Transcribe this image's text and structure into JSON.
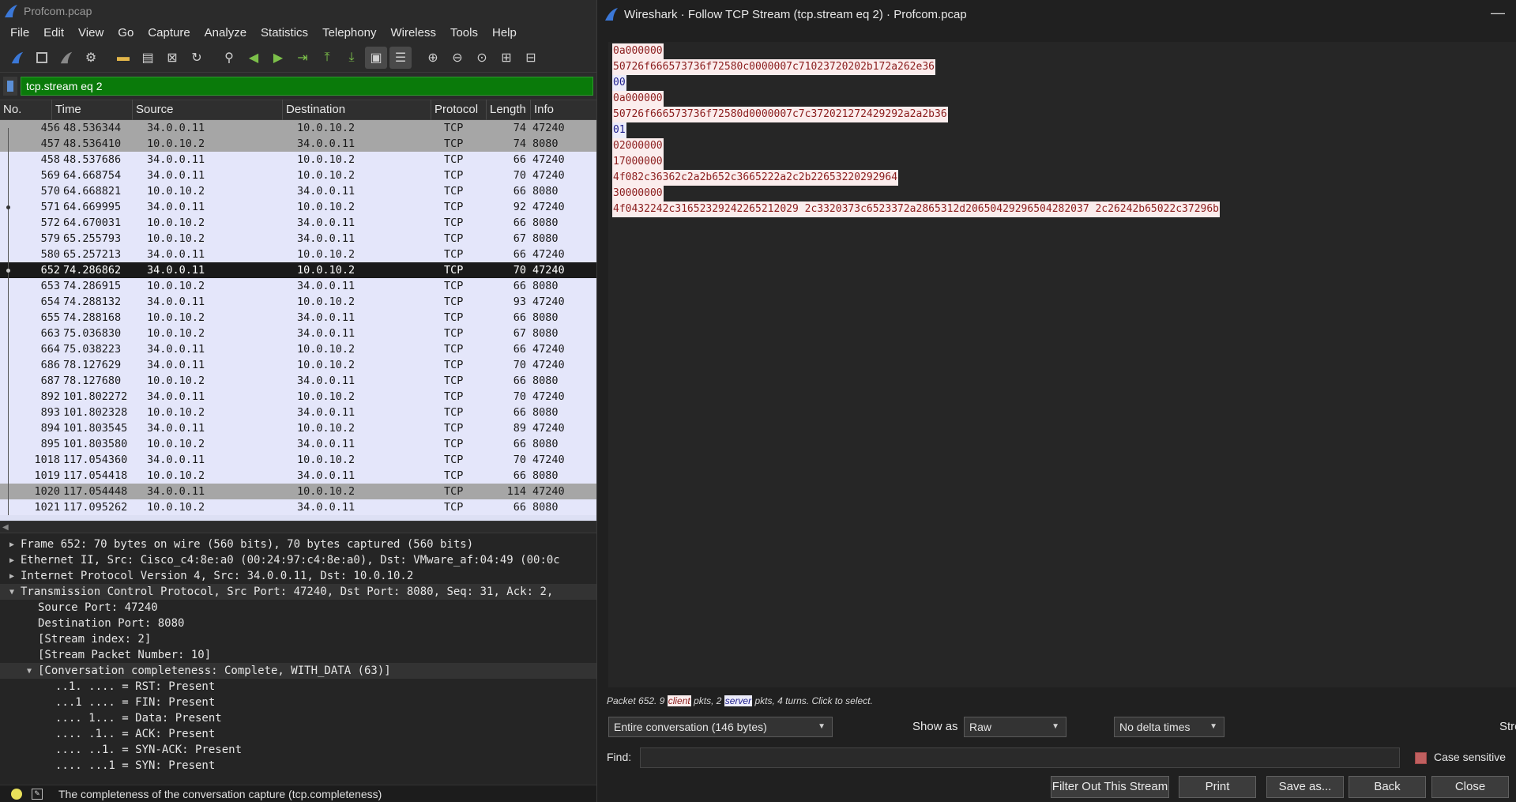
{
  "main_window": {
    "title": "Profcom.pcap",
    "menu": [
      "File",
      "Edit",
      "View",
      "Go",
      "Capture",
      "Analyze",
      "Statistics",
      "Telephony",
      "Wireless",
      "Tools",
      "Help"
    ],
    "filter_value": "tcp.stream eq 2",
    "columns": [
      "No.",
      "Time",
      "Source",
      "Destination",
      "Protocol",
      "Length",
      "Info"
    ],
    "packets": [
      {
        "no": "456",
        "time": "48.536344",
        "src": "34.0.0.11",
        "dst": "10.0.10.2",
        "proto": "TCP",
        "len": "74",
        "info": "47240"
      },
      {
        "no": "457",
        "time": "48.536410",
        "src": "10.0.10.2",
        "dst": "34.0.0.11",
        "proto": "TCP",
        "len": "74",
        "info": "8080"
      },
      {
        "no": "458",
        "time": "48.537686",
        "src": "34.0.0.11",
        "dst": "10.0.10.2",
        "proto": "TCP",
        "len": "66",
        "info": "47240"
      },
      {
        "no": "569",
        "time": "64.668754",
        "src": "34.0.0.11",
        "dst": "10.0.10.2",
        "proto": "TCP",
        "len": "70",
        "info": "47240"
      },
      {
        "no": "570",
        "time": "64.668821",
        "src": "10.0.10.2",
        "dst": "34.0.0.11",
        "proto": "TCP",
        "len": "66",
        "info": "8080"
      },
      {
        "no": "571",
        "time": "64.669995",
        "src": "34.0.0.11",
        "dst": "10.0.10.2",
        "proto": "TCP",
        "len": "92",
        "info": "47240"
      },
      {
        "no": "572",
        "time": "64.670031",
        "src": "10.0.10.2",
        "dst": "34.0.0.11",
        "proto": "TCP",
        "len": "66",
        "info": "8080"
      },
      {
        "no": "579",
        "time": "65.255793",
        "src": "10.0.10.2",
        "dst": "34.0.0.11",
        "proto": "TCP",
        "len": "67",
        "info": "8080"
      },
      {
        "no": "580",
        "time": "65.257213",
        "src": "34.0.0.11",
        "dst": "10.0.10.2",
        "proto": "TCP",
        "len": "66",
        "info": "47240"
      },
      {
        "no": "652",
        "time": "74.286862",
        "src": "34.0.0.11",
        "dst": "10.0.10.2",
        "proto": "TCP",
        "len": "70",
        "info": "47240"
      },
      {
        "no": "653",
        "time": "74.286915",
        "src": "10.0.10.2",
        "dst": "34.0.0.11",
        "proto": "TCP",
        "len": "66",
        "info": "8080"
      },
      {
        "no": "654",
        "time": "74.288132",
        "src": "34.0.0.11",
        "dst": "10.0.10.2",
        "proto": "TCP",
        "len": "93",
        "info": "47240"
      },
      {
        "no": "655",
        "time": "74.288168",
        "src": "10.0.10.2",
        "dst": "34.0.0.11",
        "proto": "TCP",
        "len": "66",
        "info": "8080"
      },
      {
        "no": "663",
        "time": "75.036830",
        "src": "10.0.10.2",
        "dst": "34.0.0.11",
        "proto": "TCP",
        "len": "67",
        "info": "8080"
      },
      {
        "no": "664",
        "time": "75.038223",
        "src": "34.0.0.11",
        "dst": "10.0.10.2",
        "proto": "TCP",
        "len": "66",
        "info": "47240"
      },
      {
        "no": "686",
        "time": "78.127629",
        "src": "34.0.0.11",
        "dst": "10.0.10.2",
        "proto": "TCP",
        "len": "70",
        "info": "47240"
      },
      {
        "no": "687",
        "time": "78.127680",
        "src": "10.0.10.2",
        "dst": "34.0.0.11",
        "proto": "TCP",
        "len": "66",
        "info": "8080"
      },
      {
        "no": "892",
        "time": "101.802272",
        "src": "34.0.0.11",
        "dst": "10.0.10.2",
        "proto": "TCP",
        "len": "70",
        "info": "47240"
      },
      {
        "no": "893",
        "time": "101.802328",
        "src": "10.0.10.2",
        "dst": "34.0.0.11",
        "proto": "TCP",
        "len": "66",
        "info": "8080"
      },
      {
        "no": "894",
        "time": "101.803545",
        "src": "34.0.0.11",
        "dst": "10.0.10.2",
        "proto": "TCP",
        "len": "89",
        "info": "47240"
      },
      {
        "no": "895",
        "time": "101.803580",
        "src": "10.0.10.2",
        "dst": "34.0.0.11",
        "proto": "TCP",
        "len": "66",
        "info": "8080"
      },
      {
        "no": "1018",
        "time": "117.054360",
        "src": "34.0.0.11",
        "dst": "10.0.10.2",
        "proto": "TCP",
        "len": "70",
        "info": "47240"
      },
      {
        "no": "1019",
        "time": "117.054418",
        "src": "10.0.10.2",
        "dst": "34.0.0.11",
        "proto": "TCP",
        "len": "66",
        "info": "8080"
      },
      {
        "no": "1020",
        "time": "117.054448",
        "src": "34.0.0.11",
        "dst": "10.0.10.2",
        "proto": "TCP",
        "len": "114",
        "info": "47240"
      },
      {
        "no": "1021",
        "time": "117.095262",
        "src": "10.0.10.2",
        "dst": "34.0.0.11",
        "proto": "TCP",
        "len": "66",
        "info": "8080"
      }
    ],
    "details": [
      {
        "text": "Frame 652: 70 bytes on wire (560 bits), 70 bytes captured (560 bits)",
        "level": 0,
        "expander": "collapsed"
      },
      {
        "text": "Ethernet II, Src: Cisco_c4:8e:a0 (00:24:97:c4:8e:a0), Dst: VMware_af:04:49 (00:0c",
        "level": 0,
        "expander": "collapsed"
      },
      {
        "text": "Internet Protocol Version 4, Src: 34.0.0.11, Dst: 10.0.10.2",
        "level": 0,
        "expander": "collapsed"
      },
      {
        "text": "Transmission Control Protocol, Src Port: 47240, Dst Port: 8080, Seq: 31, Ack: 2,",
        "level": 0,
        "expander": "expanded"
      },
      {
        "text": "Source Port: 47240",
        "level": 1,
        "expander": "none"
      },
      {
        "text": "Destination Port: 8080",
        "level": 1,
        "expander": "none"
      },
      {
        "text": "[Stream index: 2]",
        "level": 1,
        "expander": "none"
      },
      {
        "text": "[Stream Packet Number: 10]",
        "level": 1,
        "expander": "none"
      },
      {
        "text": "[Conversation completeness: Complete, WITH_DATA (63)]",
        "level": 1,
        "expander": "expanded"
      },
      {
        "text": "..1. .... = RST: Present",
        "level": 2,
        "expander": "none"
      },
      {
        "text": "...1 .... = FIN: Present",
        "level": 2,
        "expander": "none"
      },
      {
        "text": ".... 1... = Data: Present",
        "level": 2,
        "expander": "none"
      },
      {
        "text": ".... .1.. = ACK: Present",
        "level": 2,
        "expander": "none"
      },
      {
        "text": ".... ..1. = SYN-ACK: Present",
        "level": 2,
        "expander": "none"
      },
      {
        "text": ".... ...1 = SYN: Present",
        "level": 2,
        "expander": "none"
      }
    ],
    "status_text": "The completeness of the conversation capture (tcp.completeness)"
  },
  "dialog": {
    "title": "Wireshark · Follow TCP Stream (tcp.stream eq 2) · Profcom.pcap",
    "stream_lines": [
      {
        "dir": "client",
        "text": "0a000000"
      },
      {
        "dir": "client",
        "text": "50726f666573736f72580c0000007c71023720202b172a262e36"
      },
      {
        "dir": "server",
        "text": "00"
      },
      {
        "dir": "client",
        "text": "0a000000"
      },
      {
        "dir": "client",
        "text": "50726f666573736f72580d0000007c7c372021272429292a2a2b36"
      },
      {
        "dir": "server",
        "text": "01"
      },
      {
        "dir": "client",
        "text": "02000000"
      },
      {
        "dir": "client",
        "text": "17000000"
      },
      {
        "dir": "client",
        "text": "4f082c36362c2a2b652c3665222a2c2b22653220292964"
      },
      {
        "dir": "client",
        "text": "30000000"
      },
      {
        "dir": "client",
        "text": "4f0432242c31652329242265212029 2c3320373c6523372a2865312d20650429296504282037 2c26242b65022c37296b"
      }
    ],
    "packet_info": {
      "prefix": "Packet 652. 9 ",
      "client_word": "client",
      "middle": " pkts, 2 ",
      "server_word": "server",
      "suffix": " pkts, 4 turns. Click to select."
    },
    "conversation_select": "Entire conversation (146 bytes)",
    "show_as_label": "Show as",
    "show_as_value": "Raw",
    "delta_value": "No delta times",
    "stream_label": "Stre",
    "find_label": "Find:",
    "find_value": "",
    "case_sensitive_label": "Case sensitive",
    "buttons": {
      "filter_out": "Filter Out This Stream",
      "print": "Print",
      "save_as": "Save as...",
      "back": "Back",
      "close": "Close"
    },
    "colors": {
      "client_fg": "#8b1d1d",
      "client_bg": "#fbeded",
      "server_fg": "#1d1d8b",
      "server_bg": "#ececfa"
    }
  }
}
